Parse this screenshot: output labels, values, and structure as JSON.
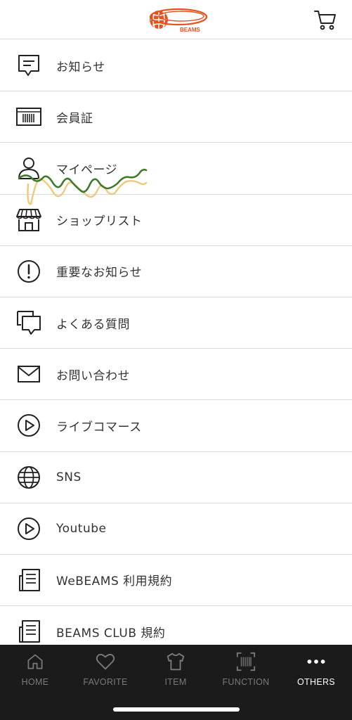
{
  "header": {
    "logo_text": "BEAMS",
    "cart_icon": "cart-icon",
    "brand_color": "#e8501e"
  },
  "menu": {
    "items": [
      {
        "label": "お知らせ",
        "icon": "message-icon"
      },
      {
        "label": "会員証",
        "icon": "barcode-icon"
      },
      {
        "label": "マイページ",
        "icon": "person-icon"
      },
      {
        "label": "ショップリスト",
        "icon": "shop-icon"
      },
      {
        "label": "重要なお知らせ",
        "icon": "alert-icon"
      },
      {
        "label": "よくある質問",
        "icon": "chat-icon"
      },
      {
        "label": "お問い合わせ",
        "icon": "mail-icon"
      },
      {
        "label": "ライブコマース",
        "icon": "play-icon"
      },
      {
        "label": "SNS",
        "icon": "globe-icon"
      },
      {
        "label": "Youtube",
        "icon": "play-icon"
      },
      {
        "label": "WeBEAMS 利用規約",
        "icon": "document-icon"
      },
      {
        "label": "BEAMS CLUB 規約",
        "icon": "document-icon"
      }
    ]
  },
  "tabbar": {
    "tabs": [
      {
        "label": "HOME",
        "icon": "home-icon",
        "active": false
      },
      {
        "label": "FAVORITE",
        "icon": "heart-icon",
        "active": false
      },
      {
        "label": "ITEM",
        "icon": "tshirt-icon",
        "active": false
      },
      {
        "label": "FUNCTION",
        "icon": "barcode-scan-icon",
        "active": false
      },
      {
        "label": "OTHERS",
        "icon": "more-icon",
        "active": true
      }
    ]
  }
}
